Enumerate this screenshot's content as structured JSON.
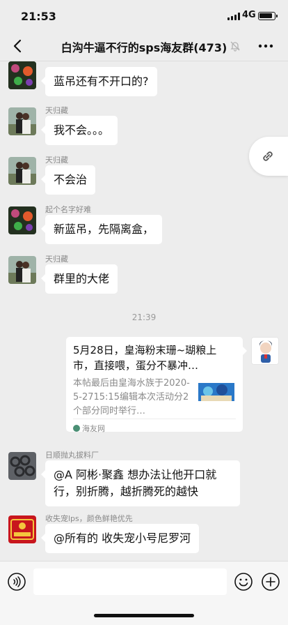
{
  "status_bar": {
    "time": "21:53",
    "network": "4G"
  },
  "header": {
    "title": "白沟牛逼不行的sps海友群(473)"
  },
  "messages": [
    {
      "sender": "",
      "text": "蓝吊还有不开口的?"
    },
    {
      "sender": "天归藏",
      "text": "我不会。。。"
    },
    {
      "sender": "天归藏",
      "text": "不会治"
    },
    {
      "sender": "起个名字好难",
      "text": "新蓝吊，先隔离盒，"
    },
    {
      "sender": "天归藏",
      "text": "群里的大佬"
    }
  ],
  "timestamp": "21:39",
  "link_card": {
    "title": "5月28日，皇海粉末珊~瑚粮上市，直接喂，蛋分不暴冲…",
    "description": "本帖最后由皇海水族于2020-5-2715:15编辑本次活动分2个部分同时举行…",
    "source": "海友网"
  },
  "messages2": [
    {
      "sender": "日顺抛丸拔料厂",
      "text": "@A 阿彬·聚鑫 想办法让他开口就行，别折腾，越折腾死的越快"
    },
    {
      "sender": "收失宠lps，颜色鲜艳优先",
      "text": "@所有的 收失宠小号尼罗河"
    }
  ],
  "colors": {
    "background": "#ededed",
    "bubble": "#ffffff",
    "meta_text": "#8a8a8a"
  }
}
